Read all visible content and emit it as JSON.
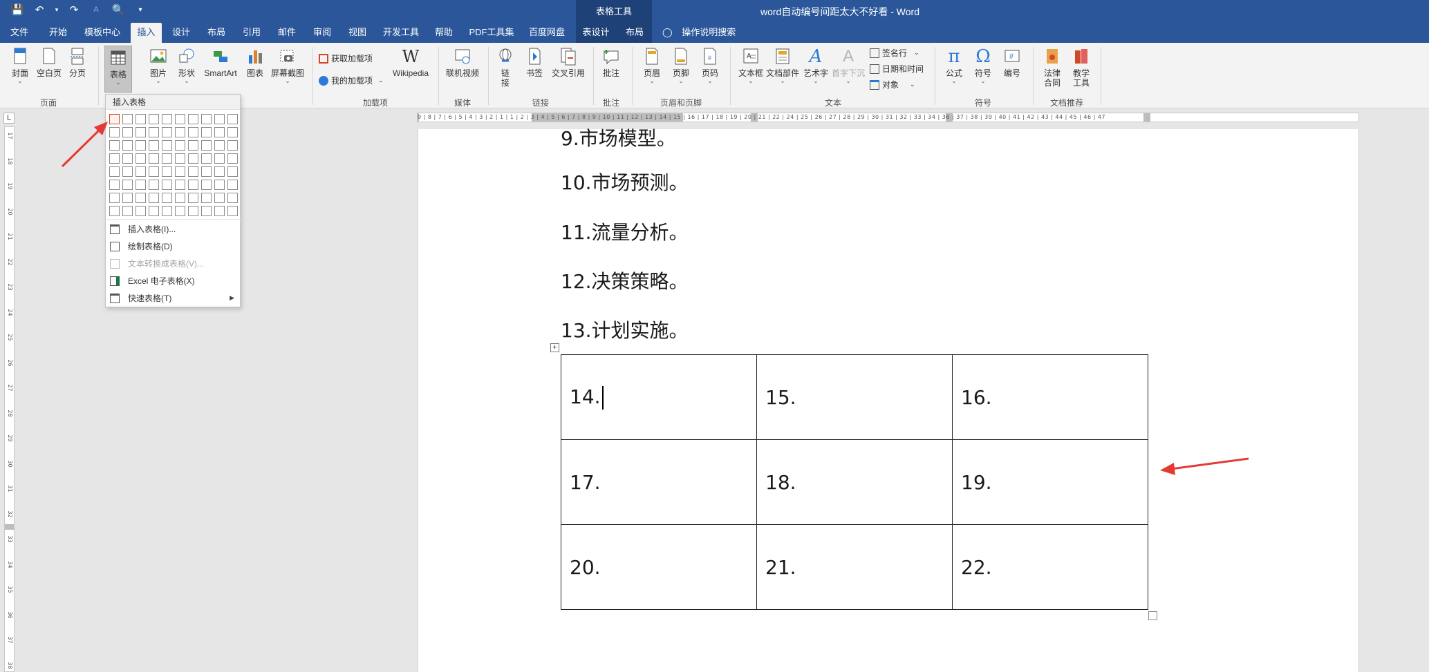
{
  "window": {
    "title": "word自动编号间距太大不好看  -  Word",
    "context_tab_group": "表格工具"
  },
  "quick_access": {
    "save_icon": "save-icon",
    "undo_icon": "undo-icon",
    "redo_icon": "redo-icon",
    "font_size_icon": "font-size-icon",
    "print_preview_icon": "print-preview-icon",
    "customize_icon": "customize-qat-icon"
  },
  "tabs": [
    "文件",
    "开始",
    "模板中心",
    "插入",
    "设计",
    "布局",
    "引用",
    "邮件",
    "审阅",
    "视图",
    "开发工具",
    "帮助",
    "PDF工具集",
    "百度网盘",
    "表设计",
    "布局"
  ],
  "active_tab": "插入",
  "tell_me": "操作说明搜索",
  "ribbon": {
    "pages": {
      "cover": "封面",
      "blank": "空白页",
      "break": "分页",
      "group": "页面"
    },
    "table": {
      "label": "表格"
    },
    "illustrations": {
      "picture": "图片",
      "shape": "形状",
      "smartart": "SmartArt",
      "chart": "图表",
      "screenshot": "屏幕截图"
    },
    "addins": {
      "get": "获取加载项",
      "my": "我的加载项",
      "wiki": "Wikipedia",
      "group": "加载项"
    },
    "media": {
      "video": "联机视频",
      "group": "媒体"
    },
    "links": {
      "link": "链接",
      "bookmark": "书签",
      "cross_ref": "交叉引用",
      "group": "链接"
    },
    "comments": {
      "comment": "批注",
      "group": "批注"
    },
    "header_footer": {
      "header": "页眉",
      "footer": "页脚",
      "page_num": "页码",
      "group": "页眉和页脚"
    },
    "text": {
      "textbox": "文本框",
      "parts": "文档部件",
      "wordart": "艺术字",
      "dropcap": "首字下沉",
      "signature": "签名行",
      "datetime": "日期和时间",
      "object": "对象",
      "group": "文本"
    },
    "symbols": {
      "equation": "公式",
      "symbol": "符号",
      "number": "编号",
      "group": "符号"
    },
    "recommend": {
      "law": "法律合同",
      "teach": "教学工具",
      "group": "文档推荐"
    }
  },
  "table_dropdown": {
    "title": "插入表格",
    "grid_rows": 8,
    "grid_cols": 10,
    "items": [
      {
        "label": "插入表格(I)...",
        "icon": "table-icon",
        "disabled": false
      },
      {
        "label": "绘制表格(D)",
        "icon": "draw-table-icon",
        "disabled": false
      },
      {
        "label": "文本转换成表格(V)...",
        "icon": "text-to-table-icon",
        "disabled": true
      },
      {
        "label": "Excel 电子表格(X)",
        "icon": "excel-icon",
        "disabled": false
      },
      {
        "label": "快速表格(T)",
        "icon": "quick-table-icon",
        "disabled": false,
        "submenu": true
      }
    ]
  },
  "document": {
    "lines": [
      "9.市场模型。",
      "10.市场预测。",
      "11.流量分析。",
      "12.决策策略。",
      "13.计划实施。"
    ],
    "table": [
      [
        "14.",
        "15.",
        "16."
      ],
      [
        "17.",
        "18.",
        "19."
      ],
      [
        "20.",
        "21.",
        "22."
      ]
    ]
  },
  "rulers": {
    "horizontal": "9 | 8 | 7 | 6 | 5 | 4 | 3 | 2 | 1  |  1 | 2 | 3 | 4 | 5 | 6 | 7 | 8 | 9 | 10 | 11 |  12 | 13 | 14 | 15 | 16 | 17 | 18 | 19 | 20 | 21 | 22 |   24 | 25 | 26 | 27 | 28 | 29 | 30 | 31 | 32 | 33 | 34 |  36 | 37 | 38 | 39 | 40 | 41 | 42 | 43 | 44 | 45 | 46 | 47",
    "vertical": [
      "17",
      "18",
      "19",
      "20",
      "21",
      "22",
      "23",
      "24",
      "25",
      "26",
      "27",
      "28",
      "29",
      "30",
      "31",
      "32",
      "33",
      "34",
      "35",
      "36",
      "37",
      "38"
    ],
    "corner": "L"
  },
  "colors": {
    "titlebar": "#2b579a",
    "context": "#1e4278",
    "annotation": "#e53935"
  }
}
